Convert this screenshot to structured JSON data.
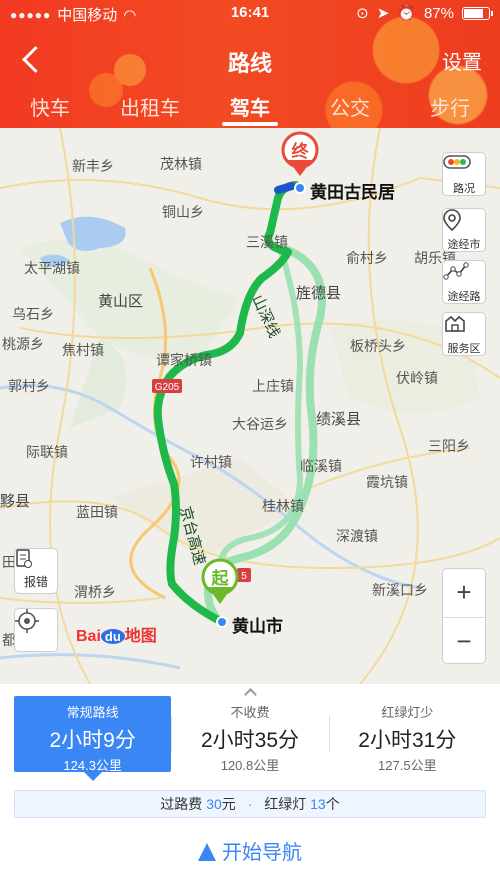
{
  "status_bar": {
    "carrier": "中国移动",
    "time": "16:41",
    "battery_text": "87%",
    "battery_level": 0.87
  },
  "header": {
    "title": "路线",
    "settings_label": "设置"
  },
  "tabs": [
    {
      "label": "快车",
      "active": false
    },
    {
      "label": "出租车",
      "active": false
    },
    {
      "label": "驾车",
      "active": true
    },
    {
      "label": "公交",
      "active": false
    },
    {
      "label": "步行",
      "active": false
    }
  ],
  "map": {
    "destination": {
      "marker": "终",
      "label": "黄田古民居"
    },
    "start": {
      "marker": "起",
      "label": "黄山市"
    },
    "road_labels": {
      "shanjing": "山深线",
      "jingtai": "京台高速",
      "g205": "G205",
      "g5": "5"
    },
    "places": [
      "新丰乡",
      "茂林镇",
      "铜山乡",
      "太平湖镇",
      "黄山区",
      "三溪镇",
      "俞村乡",
      "胡乐镇",
      "乌石乡",
      "旌德县",
      "桃源乡",
      "焦村镇",
      "谭家桥镇",
      "板桥头乡",
      "郭村乡",
      "上庄镇",
      "伏岭镇",
      "大谷运乡",
      "绩溪县",
      "际联镇",
      "许村镇",
      "临溪镇",
      "三阳乡",
      "霞坑镇",
      "黟县",
      "蓝田镇",
      "桂林镇",
      "深渡镇",
      "渭桥乡",
      "新溪口乡",
      "田镇",
      "都"
    ],
    "side_buttons": [
      {
        "name": "traffic",
        "label": "路况"
      },
      {
        "name": "waypoint",
        "label": "途经市"
      },
      {
        "name": "route-pass",
        "label": "途经路"
      },
      {
        "name": "service",
        "label": "服务区"
      }
    ],
    "report_label": "报错",
    "zoom_in": "+",
    "zoom_out": "−",
    "logo": {
      "bai": "Bai",
      "du": "du",
      "ditu": "地图"
    }
  },
  "routes": [
    {
      "label": "常规路线",
      "time": "2小时9分",
      "distance": "124.3公里",
      "active": true
    },
    {
      "label": "不收费",
      "time": "2小时35分",
      "distance": "120.8公里",
      "active": false
    },
    {
      "label": "红绿灯少",
      "time": "2小时31分",
      "distance": "127.5公里",
      "active": false
    }
  ],
  "fees": {
    "toll_label": "过路费",
    "toll_value": "30",
    "toll_unit": "元",
    "lights_label": "红绿灯",
    "lights_value": "13",
    "lights_unit": "个"
  },
  "navigate_label": "开始导航",
  "colors": {
    "header": "#f23a22",
    "accent": "#3a86f5",
    "route_main": "#1fb84a",
    "route_alt": "#9ae0b0"
  }
}
